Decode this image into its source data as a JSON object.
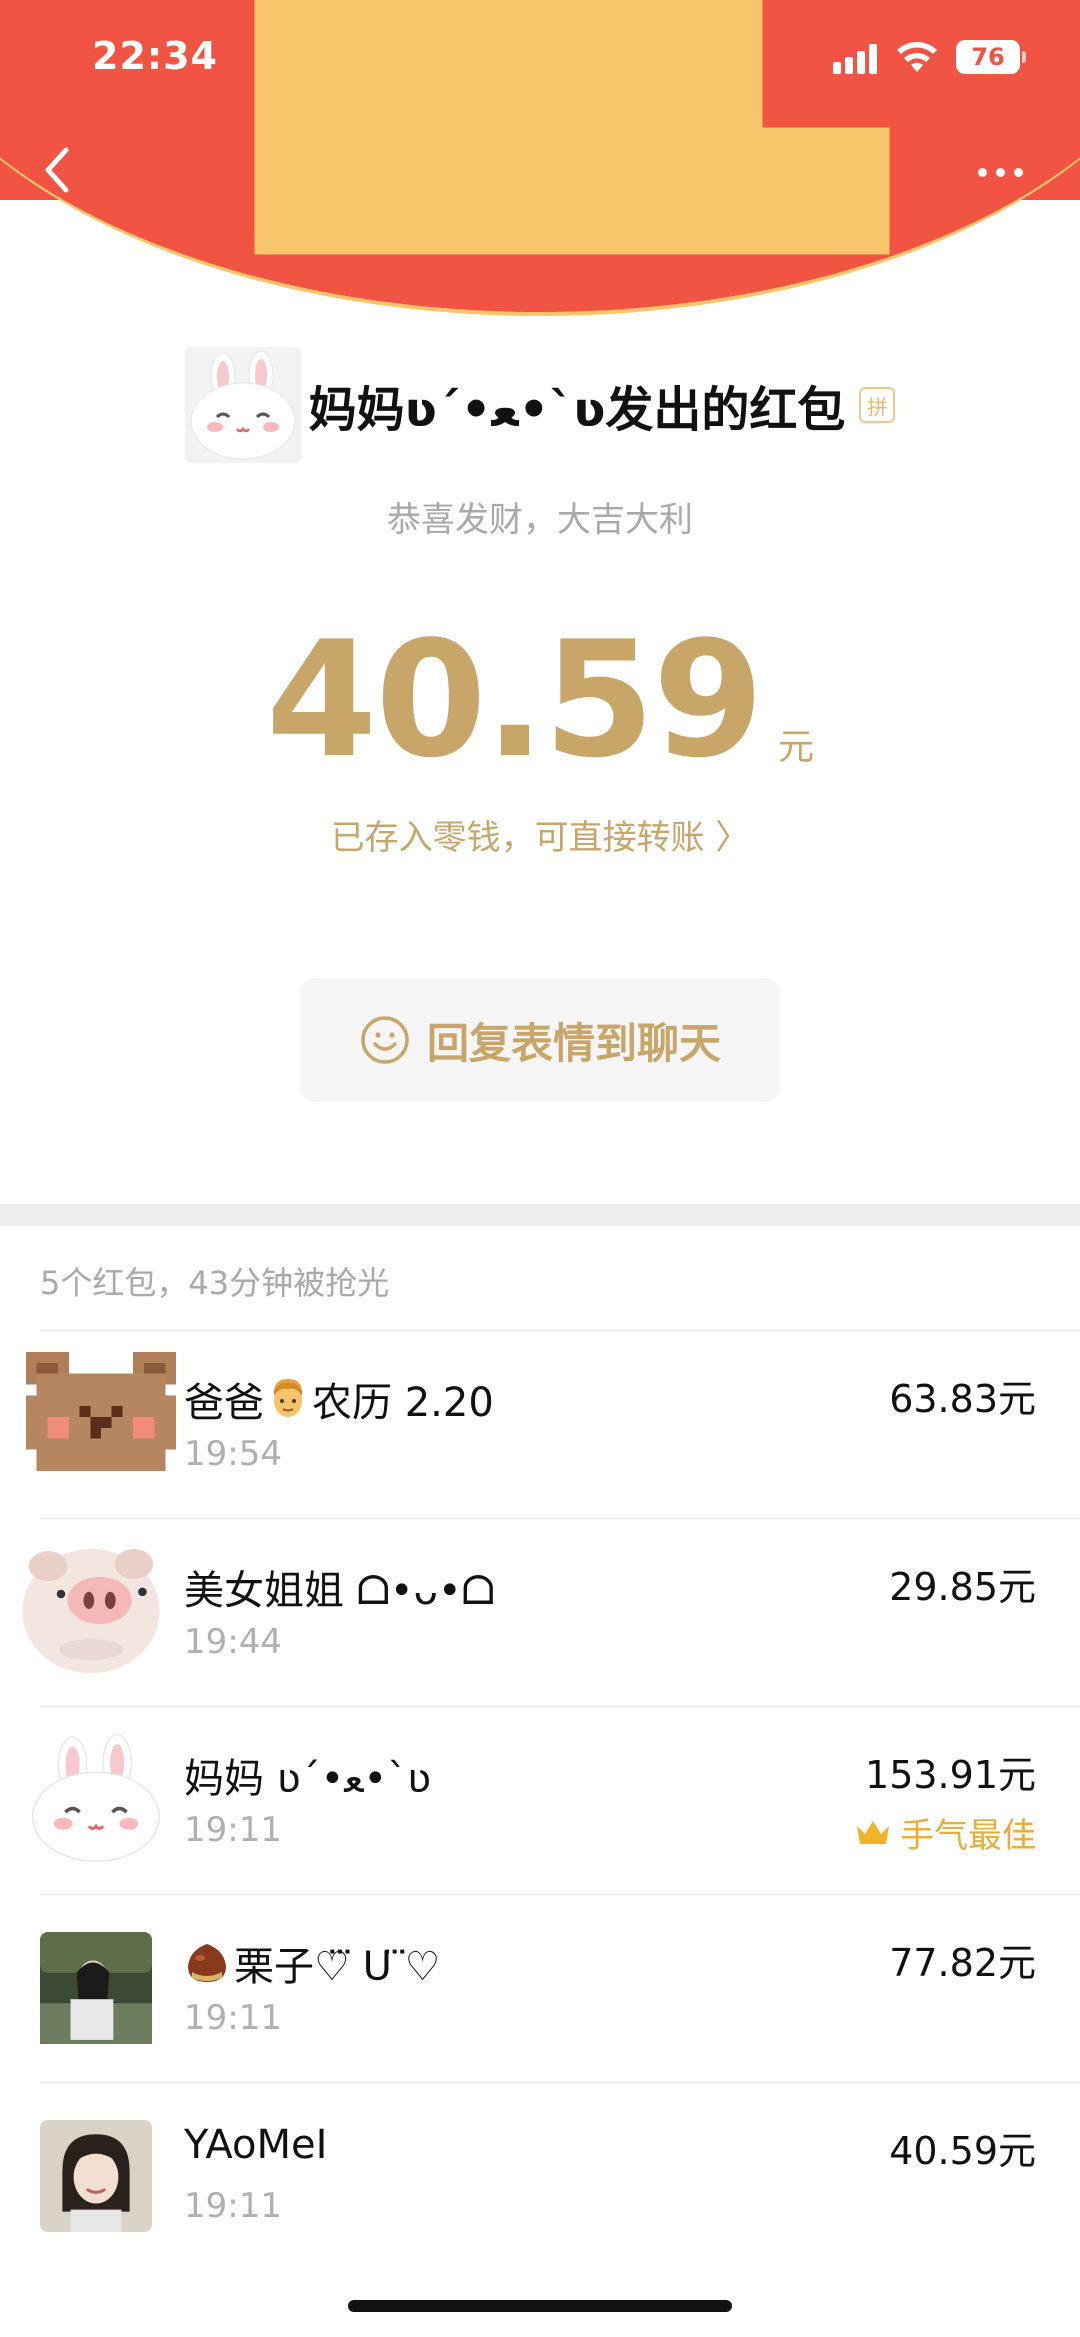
{
  "status_bar": {
    "time": "22:34",
    "battery": "76"
  },
  "colors": {
    "header_red": "#f25444",
    "gold": "#c8a66a",
    "best_luck": "#e7ae3c"
  },
  "header": {
    "sender_name": "妈妈ʋ´•ﻌ•`ʋ发出的红包",
    "pin_badge": "拼",
    "blessing": "恭喜发财，大吉大利"
  },
  "amount": {
    "value": "40.59",
    "unit": "元",
    "wallet_link": "已存入零钱，可直接转账 〉"
  },
  "reply_button": {
    "label": "回复表情到聊天"
  },
  "summary": "5个红包，43分钟被抢光",
  "records": [
    {
      "name": "爸爸",
      "name_suffix": "农历 2.20",
      "name_emoji": "man-emoji",
      "time": "19:54",
      "amount": "63.83元",
      "avatar": "bear-avatar"
    },
    {
      "name": "美女姐姐 ᗝ•ᴗ•ᗝ",
      "time": "19:44",
      "amount": "29.85元",
      "avatar": "piglet-avatar"
    },
    {
      "name": "妈妈 ʋ´•ﻌ•`ʋ",
      "time": "19:11",
      "amount": "153.91元",
      "best_luck": "手气最佳",
      "avatar": "bunny-avatar"
    },
    {
      "name": "栗子♡⃛ ᑌ ⃛♡",
      "name_emoji": "chestnut-emoji",
      "time": "19:11",
      "amount": "77.82元",
      "avatar": "photo-avatar"
    },
    {
      "name": "YAoMeI",
      "time": "19:11",
      "amount": "40.59元",
      "avatar": "girl-photo-avatar"
    }
  ]
}
